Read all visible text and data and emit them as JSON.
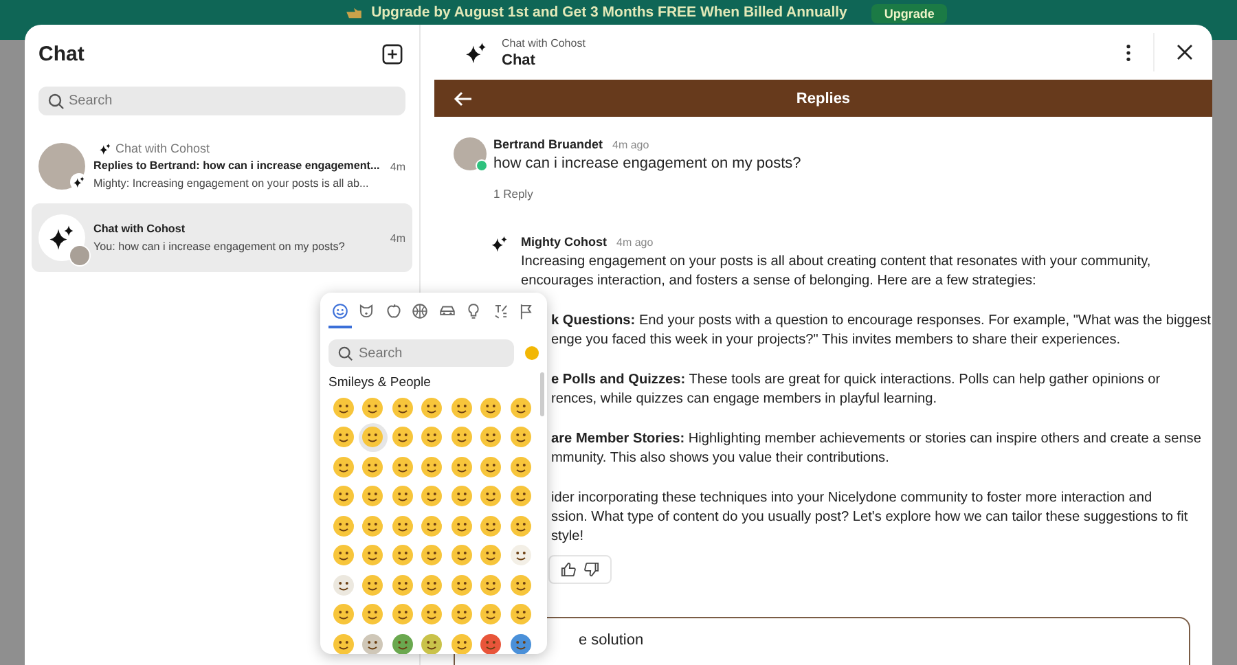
{
  "banner": {
    "text": "Upgrade by August 1st and Get 3 Months FREE When Billed Annually",
    "button": "Upgrade"
  },
  "sidebar": {
    "title": "Chat",
    "search": {
      "placeholder": "Search"
    },
    "items": [
      {
        "kind": "thread",
        "context": "Chat with Cohost",
        "title": "Replies to Bertrand: how can i increase engagement...",
        "preview": "Mighty: Increasing engagement on your posts is all ab...",
        "time": "4m",
        "selected": false
      },
      {
        "kind": "assistant",
        "title": "Chat with Cohost",
        "preview": "You: how can i increase engagement on my posts?",
        "time": "4m",
        "selected": true
      }
    ]
  },
  "header": {
    "subtitle": "Chat with Cohost",
    "title": "Chat"
  },
  "replies_bar": {
    "title": "Replies"
  },
  "question": {
    "author": "Bertrand Bruandet",
    "time": "4m ago",
    "online": true,
    "text": "how can i increase engagement on my posts?",
    "reply_count": "1 Reply"
  },
  "answer": {
    "author": "Mighty Cohost",
    "time": "4m ago",
    "paragraphs": [
      {
        "lines": [
          {
            "text": "Increasing engagement on your posts is all about creating content that resonates with your community,",
            "clipped": false
          },
          {
            "text": "encourages interaction, and fosters a sense of belonging. Here are a few strategies:",
            "clipped": false
          }
        ]
      },
      {
        "lines": [
          {
            "text": "**k Questions:** End your posts with a question to encourage responses. For example, \"What was the biggest",
            "clipped": true
          },
          {
            "text": "enge you faced this week in your projects?\" This invites members to share their experiences.",
            "clipped": true
          }
        ]
      },
      {
        "lines": [
          {
            "text": "**e Polls and Quizzes:** These tools are great for quick interactions. Polls can help gather opinions or",
            "clipped": true
          },
          {
            "text": "rences, while quizzes can engage members in playful learning.",
            "clipped": true
          }
        ]
      },
      {
        "lines": [
          {
            "text": "**are Member Stories:** Highlighting member achievements or stories can inspire others and create a sense",
            "clipped": true
          },
          {
            "text": "mmunity. This also shows you value their contributions.",
            "clipped": true
          }
        ]
      },
      {
        "lines": [
          {
            "text": "ider incorporating these techniques into your Nicelydone community to foster more interaction and",
            "clipped": true
          },
          {
            "text": "ssion. What type of content do you usually post? Let's explore how we can tailor these suggestions to fit",
            "clipped": true
          },
          {
            "text": "style!",
            "clipped": true
          }
        ]
      }
    ]
  },
  "composer": {
    "value": "e solution"
  },
  "emoji_picker": {
    "tabs": [
      {
        "selected": true
      },
      {
        "selected": false
      },
      {
        "selected": false
      },
      {
        "selected": false
      },
      {
        "selected": false
      },
      {
        "selected": false
      },
      {
        "selected": false
      },
      {
        "selected": false
      }
    ],
    "search": {
      "placeholder": "Search"
    },
    "section": "Smileys & People",
    "emojis": [
      {
        "color": "#f7c53b",
        "selected": false
      },
      {
        "color": "#f7c53b",
        "selected": false
      },
      {
        "color": "#f7c53b",
        "selected": false
      },
      {
        "color": "#f7c53b",
        "selected": false
      },
      {
        "color": "#f7c53b",
        "selected": false
      },
      {
        "color": "#f7c53b",
        "selected": false
      },
      {
        "color": "#f7c53b",
        "selected": false
      },
      {
        "color": "#f7c53b",
        "selected": false
      },
      {
        "color": "#f7c53b",
        "selected": true
      },
      {
        "color": "#f7c53b",
        "selected": false
      },
      {
        "color": "#f7c53b",
        "selected": false
      },
      {
        "color": "#f7c53b",
        "selected": false
      },
      {
        "color": "#f7c53b",
        "selected": false
      },
      {
        "color": "#f7c53b",
        "selected": false
      },
      {
        "color": "#f7c53b",
        "selected": false
      },
      {
        "color": "#f7c53b",
        "selected": false
      },
      {
        "color": "#f7c53b",
        "selected": false
      },
      {
        "color": "#f7c53b",
        "selected": false
      },
      {
        "color": "#f7c53b",
        "selected": false
      },
      {
        "color": "#f7c53b",
        "selected": false
      },
      {
        "color": "#f7c53b",
        "selected": false
      },
      {
        "color": "#f7c53b",
        "selected": false
      },
      {
        "color": "#f7c53b",
        "selected": false
      },
      {
        "color": "#f7c53b",
        "selected": false
      },
      {
        "color": "#f7c53b",
        "selected": false
      },
      {
        "color": "#f7c53b",
        "selected": false
      },
      {
        "color": "#f7c53b",
        "selected": false
      },
      {
        "color": "#f7c53b",
        "selected": false
      },
      {
        "color": "#f7c53b",
        "selected": false
      },
      {
        "color": "#f7c53b",
        "selected": false
      },
      {
        "color": "#f7c53b",
        "selected": false
      },
      {
        "color": "#f7c53b",
        "selected": false
      },
      {
        "color": "#f7c53b",
        "selected": false
      },
      {
        "color": "#f7c53b",
        "selected": false
      },
      {
        "color": "#f7c53b",
        "selected": false
      },
      {
        "color": "#f7c53b",
        "selected": false
      },
      {
        "color": "#f7c53b",
        "selected": false
      },
      {
        "color": "#f7c53b",
        "selected": false
      },
      {
        "color": "#f7c53b",
        "selected": false
      },
      {
        "color": "#f7c53b",
        "selected": false
      },
      {
        "color": "#f7c53b",
        "selected": false
      },
      {
        "color": "#f3efe6",
        "selected": false
      },
      {
        "color": "#ece8df",
        "selected": false
      },
      {
        "color": "#f7c53b",
        "selected": false
      },
      {
        "color": "#f7c53b",
        "selected": false
      },
      {
        "color": "#f7c53b",
        "selected": false
      },
      {
        "color": "#f7c53b",
        "selected": false
      },
      {
        "color": "#f7c53b",
        "selected": false
      },
      {
        "color": "#f7c53b",
        "selected": false
      },
      {
        "color": "#f7c53b",
        "selected": false
      },
      {
        "color": "#f7c53b",
        "selected": false
      },
      {
        "color": "#f7c53b",
        "selected": false
      },
      {
        "color": "#f7c53b",
        "selected": false
      },
      {
        "color": "#f7c53b",
        "selected": false
      },
      {
        "color": "#f7c53b",
        "selected": false
      },
      {
        "color": "#f7c53b",
        "selected": false
      },
      {
        "color": "#f7c53b",
        "selected": false
      },
      {
        "color": "#cfc7b8",
        "selected": false
      },
      {
        "color": "#6aa84f",
        "selected": false
      },
      {
        "color": "#c9c24a",
        "selected": false
      },
      {
        "color": "#f7c53b",
        "selected": false
      },
      {
        "color": "#e8553a",
        "selected": false
      },
      {
        "color": "#4a90d9",
        "selected": false
      }
    ]
  }
}
